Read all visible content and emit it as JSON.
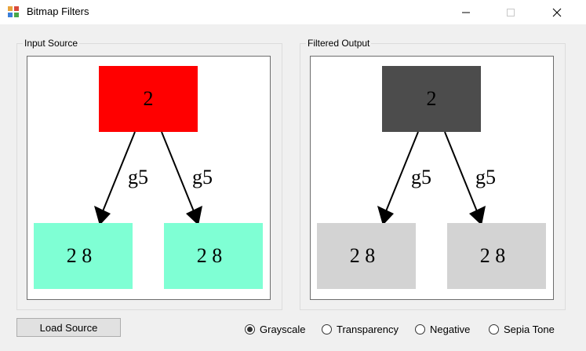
{
  "window": {
    "title": "Bitmap Filters",
    "icon": "app-icon"
  },
  "groups": {
    "input": {
      "label": "Input Source",
      "graph": {
        "root": {
          "label": "2",
          "fill": "#ff0000"
        },
        "edge_left_label": "g5",
        "edge_right_label": "g5",
        "child_left": {
          "label": "2 8",
          "fill": "#7fffd4"
        },
        "child_right": {
          "label": "2 8",
          "fill": "#7fffd4"
        }
      }
    },
    "output": {
      "label": "Filtered Output",
      "graph": {
        "root": {
          "label": "2",
          "fill": "#4c4c4c"
        },
        "edge_left_label": "g5",
        "edge_right_label": "g5",
        "child_left": {
          "label": "2 8",
          "fill": "#d3d3d3"
        },
        "child_right": {
          "label": "2 8",
          "fill": "#d3d3d3"
        }
      }
    }
  },
  "load_button_label": "Load Source",
  "filters": [
    {
      "label": "Grayscale",
      "checked": true
    },
    {
      "label": "Transparency",
      "checked": false
    },
    {
      "label": "Negative",
      "checked": false
    },
    {
      "label": "Sepia Tone",
      "checked": false
    }
  ]
}
